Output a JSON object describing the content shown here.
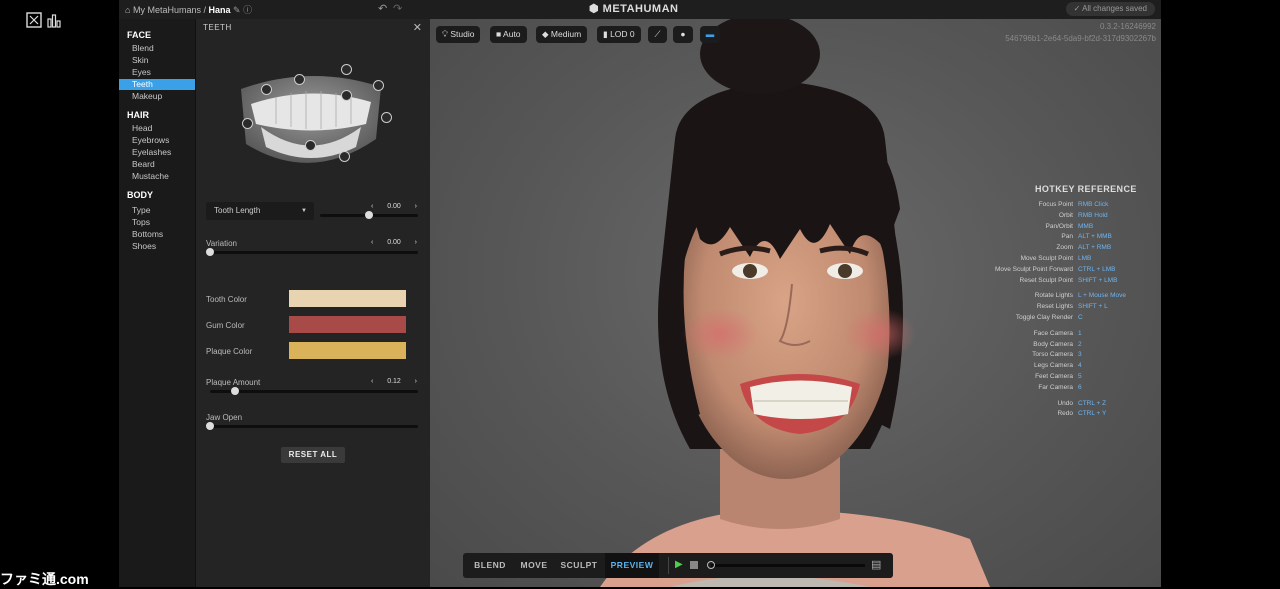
{
  "breadcrumb": {
    "root": "My MetaHumans /",
    "current": "Hana"
  },
  "brand": "METAHUMAN",
  "save_status": "All changes saved",
  "nav": {
    "sections": [
      {
        "title": "FACE",
        "items": [
          "Blend",
          "Skin",
          "Eyes",
          "Teeth",
          "Makeup"
        ]
      },
      {
        "title": "HAIR",
        "items": [
          "Head",
          "Eyebrows",
          "Eyelashes",
          "Beard",
          "Mustache"
        ]
      },
      {
        "title": "BODY",
        "items": [
          "Type",
          "Tops",
          "Bottoms",
          "Shoes"
        ]
      }
    ],
    "active": "Teeth"
  },
  "panel": {
    "title": "TEETH",
    "tooth_length": {
      "label": "Tooth Length",
      "value": "0.00",
      "level": 0.5
    },
    "variation": {
      "label": "Variation",
      "value": "0.00",
      "level": 0.0
    },
    "tooth_color": {
      "label": "Tooth Color",
      "color": "#e8d4b0"
    },
    "gum_color": {
      "label": "Gum Color",
      "color": "#a84a48"
    },
    "plaque_color": {
      "label": "Plaque Color",
      "color": "#d9b25a"
    },
    "plaque_amount": {
      "label": "Plaque Amount",
      "value": "0.12",
      "level": 0.12
    },
    "jaw_open": {
      "label": "Jaw Open",
      "level": 0.0
    },
    "reset_label": "RESET ALL"
  },
  "viewport": {
    "toolbar": {
      "lighting": "Studio",
      "camera": "Auto",
      "quality": "Medium",
      "lod": "LOD 0"
    },
    "version": "0.3.2-16246992",
    "id": "546796b1-2e64-5da9-bf2d-317d9302267b",
    "hotkey_title": "HOTKEY REFERENCE",
    "hotkeys": [
      [
        "Focus Point",
        "RMB Click"
      ],
      [
        "Orbit",
        "RMB Hold"
      ],
      [
        "Pan/Orbit",
        "MMB"
      ],
      [
        "Pan",
        "ALT + MMB"
      ],
      [
        "Zoom",
        "ALT + RMB"
      ],
      [
        "Move Sculpt Point",
        "LMB"
      ],
      [
        "Move Sculpt Point Forward",
        "CTRL + LMB"
      ],
      [
        "Reset Sculpt Point",
        "SHIFT + LMB"
      ],
      [
        "Rotate Lights",
        "L + Mouse Move"
      ],
      [
        "Reset Lights",
        "SHIFT + L"
      ],
      [
        "Toggle Clay Render",
        "C"
      ],
      [
        "Face Camera",
        "1"
      ],
      [
        "Body Camera",
        "2"
      ],
      [
        "Torso Camera",
        "3"
      ],
      [
        "Legs Camera",
        "4"
      ],
      [
        "Feet Camera",
        "5"
      ],
      [
        "Far Camera",
        "6"
      ],
      [
        "Undo",
        "CTRL + Z"
      ],
      [
        "Redo",
        "CTRL + Y"
      ]
    ],
    "modes": [
      "BLEND",
      "MOVE",
      "SCULPT",
      "PREVIEW"
    ],
    "active_mode": "PREVIEW"
  },
  "colors": {
    "accent": "#3aa0e8",
    "hotkey": "#6fb4f0"
  },
  "watermark": "ファミ通.com"
}
